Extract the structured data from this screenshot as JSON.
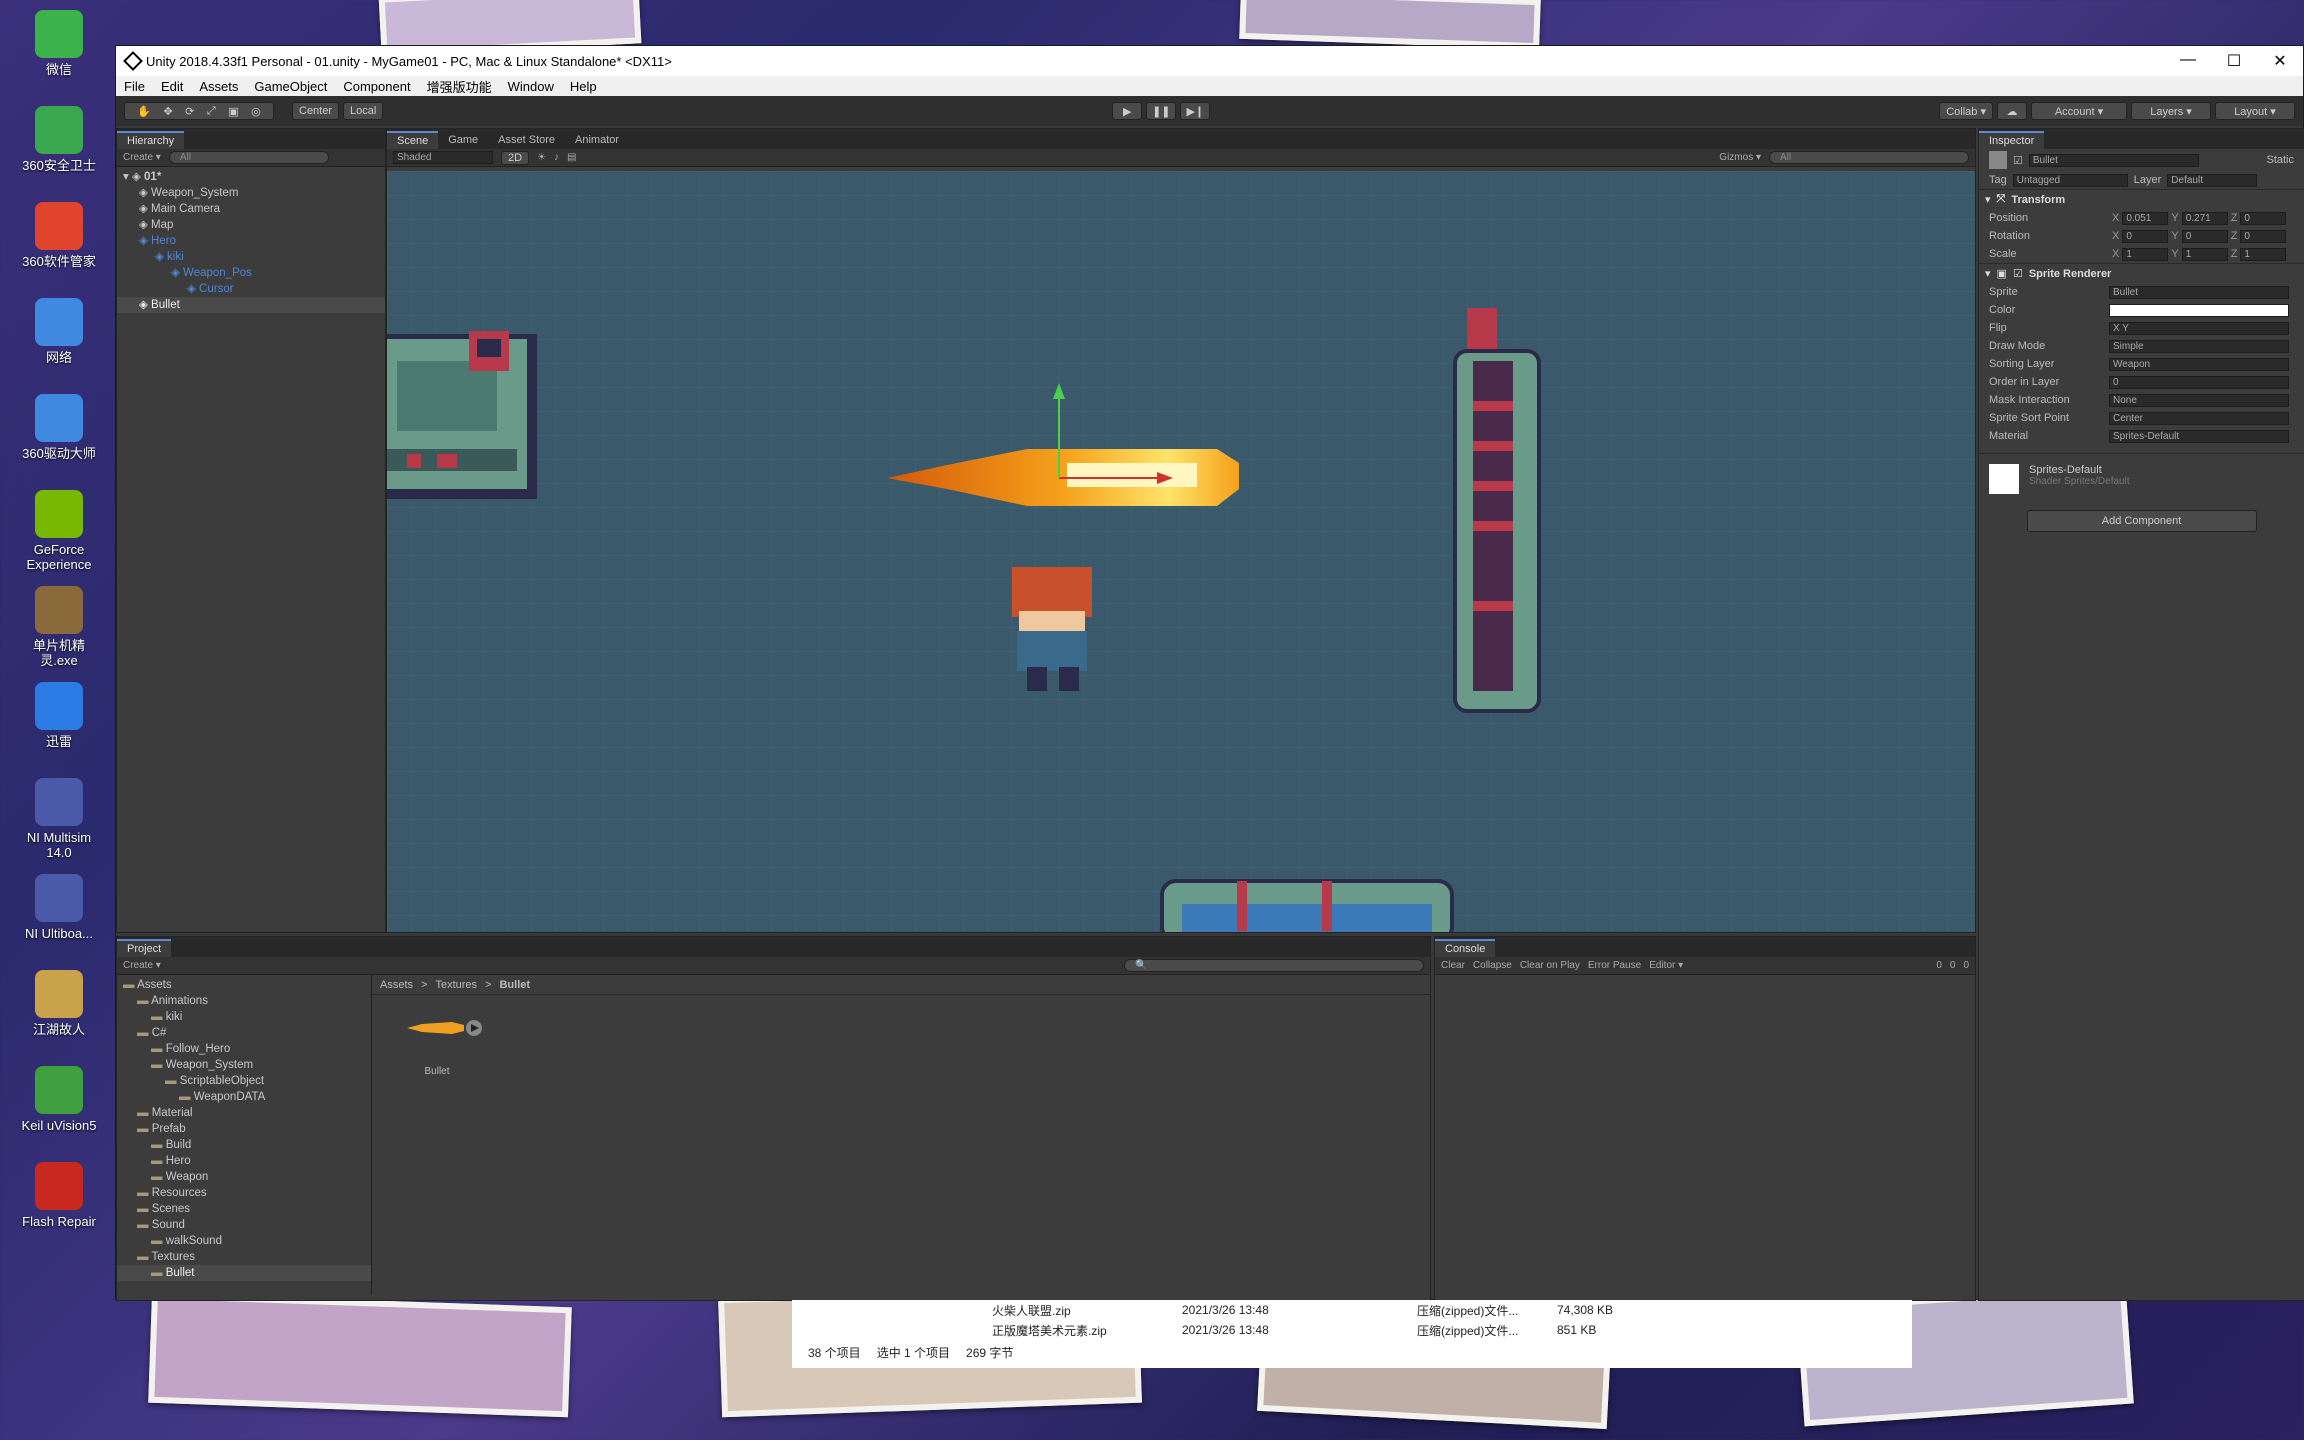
{
  "desktop": {
    "icons": [
      {
        "label": "微信",
        "color": "#3cb34a"
      },
      {
        "label": "360安全卫士",
        "color": "#39a84e"
      },
      {
        "label": "360软件管家",
        "color": "#e0452b"
      },
      {
        "label": "网络",
        "color": "#3f8ae0"
      },
      {
        "label": "360驱动大师",
        "color": "#3f8ae0"
      },
      {
        "label": "GeForce Experience",
        "color": "#76b900"
      },
      {
        "label": "单片机精灵.exe",
        "color": "#8a6a3a"
      },
      {
        "label": "迅雷",
        "color": "#2a7be4"
      },
      {
        "label": "NI Multisim 14.0",
        "color": "#4a5aa8"
      },
      {
        "label": "NI Ultiboa...",
        "color": "#4a5aa8"
      },
      {
        "label": "江湖故人",
        "color": "#c9a24a"
      },
      {
        "label": "Keil uVision5",
        "color": "#3fa03f"
      },
      {
        "label": "Flash Repair",
        "color": "#c8281e"
      }
    ]
  },
  "window": {
    "title": "Unity 2018.4.33f1 Personal - 01.unity - MyGame01 - PC, Mac & Linux Standalone* <DX11>",
    "min": "—",
    "max": "☐",
    "close": "✕"
  },
  "menu": [
    "File",
    "Edit",
    "Assets",
    "GameObject",
    "Component",
    "增强版功能",
    "Window",
    "Help"
  ],
  "toolbar": {
    "pivot": "Center",
    "space": "Local",
    "collab": "Collab ▾",
    "account": "Account ▾",
    "layers": "Layers ▾",
    "layout": "Layout ▾"
  },
  "hierarchy": {
    "tab": "Hierarchy",
    "create": "Create ▾",
    "search": "All",
    "scene": "01*",
    "items": [
      {
        "label": "Weapon_System",
        "depth": 1,
        "blue": false,
        "sel": false
      },
      {
        "label": "Main Camera",
        "depth": 1,
        "blue": false,
        "sel": false
      },
      {
        "label": "Map",
        "depth": 1,
        "blue": false,
        "sel": false
      },
      {
        "label": "Hero",
        "depth": 1,
        "blue": true,
        "sel": false
      },
      {
        "label": "kiki",
        "depth": 2,
        "blue": true,
        "sel": false
      },
      {
        "label": "Weapon_Pos",
        "depth": 3,
        "blue": true,
        "sel": false
      },
      {
        "label": "Cursor",
        "depth": 4,
        "blue": true,
        "sel": false
      },
      {
        "label": "Bullet",
        "depth": 1,
        "blue": false,
        "sel": true
      }
    ]
  },
  "sceneview": {
    "tabs": [
      "Scene",
      "Game",
      "Asset Store",
      "Animator"
    ],
    "shading": "Shaded",
    "mode2d": "2D",
    "gizmos": "Gizmos ▾",
    "search": "All"
  },
  "inspector": {
    "tab": "Inspector",
    "name": "Bullet",
    "static": "Static",
    "tag_label": "Tag",
    "tag": "Untagged",
    "layer_label": "Layer",
    "layer": "Default",
    "transform": {
      "title": "Transform",
      "rows": [
        {
          "label": "Position",
          "x": "0.051",
          "y": "0.271",
          "z": "0"
        },
        {
          "label": "Rotation",
          "x": "0",
          "y": "0",
          "z": "0"
        },
        {
          "label": "Scale",
          "x": "1",
          "y": "1",
          "z": "1"
        }
      ]
    },
    "sprite_renderer": {
      "title": "Sprite Renderer",
      "rows": [
        {
          "label": "Sprite",
          "value": "Bullet"
        },
        {
          "label": "Color",
          "value": ""
        },
        {
          "label": "Flip",
          "value": "X  Y"
        },
        {
          "label": "Draw Mode",
          "value": "Simple"
        },
        {
          "label": "Sorting Layer",
          "value": "Weapon"
        },
        {
          "label": "Order in Layer",
          "value": "0"
        },
        {
          "label": "Mask Interaction",
          "value": "None"
        },
        {
          "label": "Sprite Sort Point",
          "value": "Center"
        },
        {
          "label": "Material",
          "value": "Sprites-Default"
        }
      ]
    },
    "material": {
      "name": "Sprites-Default",
      "shader_label": "Shader",
      "shader": "Sprites/Default"
    },
    "add_component": "Add Component"
  },
  "project": {
    "tab": "Project",
    "create": "Create ▾",
    "breadcrumb": [
      "Assets",
      "Textures",
      "Bullet"
    ],
    "tree": [
      {
        "label": "Assets",
        "depth": 0
      },
      {
        "label": "Animations",
        "depth": 1
      },
      {
        "label": "kiki",
        "depth": 2
      },
      {
        "label": "C#",
        "depth": 1
      },
      {
        "label": "Follow_Hero",
        "depth": 2
      },
      {
        "label": "Weapon_System",
        "depth": 2
      },
      {
        "label": "ScriptableObject",
        "depth": 3
      },
      {
        "label": "WeaponDATA",
        "depth": 4
      },
      {
        "label": "Material",
        "depth": 1
      },
      {
        "label": "Prefab",
        "depth": 1
      },
      {
        "label": "Build",
        "depth": 2
      },
      {
        "label": "Hero",
        "depth": 2
      },
      {
        "label": "Weapon",
        "depth": 2
      },
      {
        "label": "Resources",
        "depth": 1
      },
      {
        "label": "Scenes",
        "depth": 1
      },
      {
        "label": "Sound",
        "depth": 1
      },
      {
        "label": "walkSound",
        "depth": 2
      },
      {
        "label": "Textures",
        "depth": 1
      },
      {
        "label": "Bullet",
        "depth": 2
      }
    ],
    "asset": "Bullet"
  },
  "console": {
    "tab": "Console",
    "buttons": [
      "Clear",
      "Collapse",
      "Clear on Play",
      "Error Pause",
      "Editor ▾"
    ],
    "counts": [
      "0",
      "0",
      "0"
    ]
  },
  "explorer": {
    "files": [
      {
        "name": "火柴人联盟.zip",
        "date": "2021/3/26 13:48",
        "type": "压缩(zipped)文件...",
        "size": "74,308 KB"
      },
      {
        "name": "正版魔塔美术元素.zip",
        "date": "2021/3/26 13:48",
        "type": "压缩(zipped)文件...",
        "size": "851 KB"
      }
    ],
    "status": [
      "38 个项目",
      "选中 1 个项目",
      "269 字节"
    ]
  }
}
